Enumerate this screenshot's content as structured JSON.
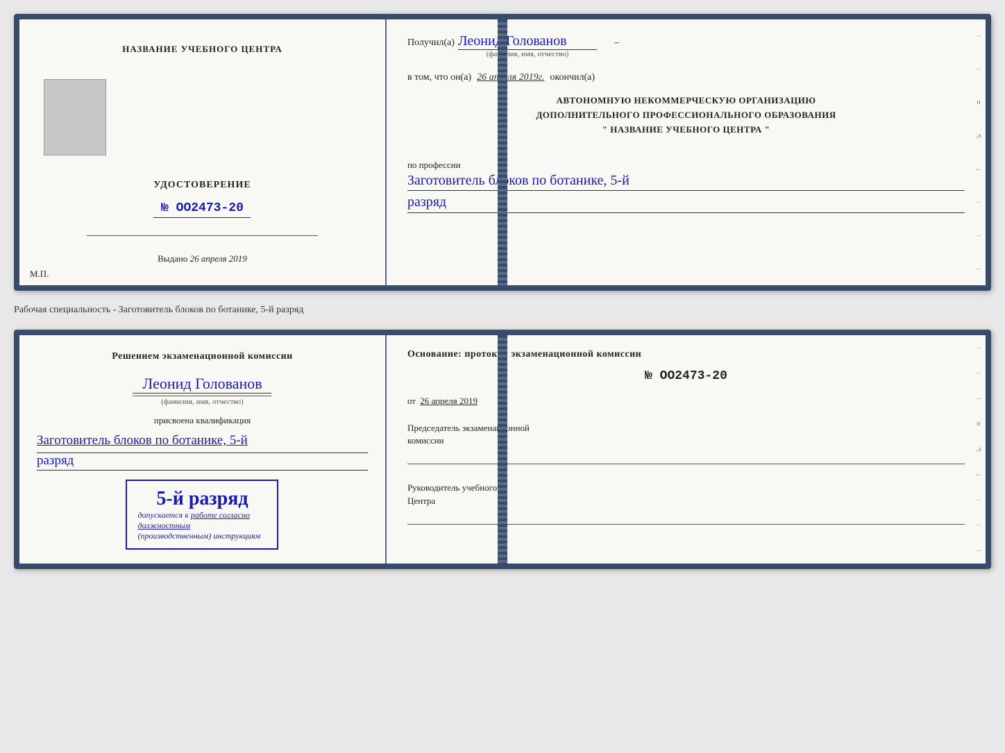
{
  "page": {
    "background": "#e8e8e8"
  },
  "top_document": {
    "left": {
      "training_center_label": "НАЗВАНИЕ УЧЕБНОГО ЦЕНТРА",
      "certificate_title": "УДОСТОВЕРЕНИЕ",
      "certificate_number": "№ OO2473-20",
      "issued_label": "Выдано",
      "issued_date": "26 апреля 2019",
      "mp_label": "М.П."
    },
    "right": {
      "received_prefix": "Получил(а)",
      "recipient_name": "Леонид Голованов",
      "fio_label": "(фамилия, имя, отчество)",
      "certifies_prefix": "в том, что он(а)",
      "completed_date": "26 апреля 2019г.",
      "completed_suffix": "окончил(а)",
      "org_line1": "АВТОНОМНУЮ НЕКОММЕРЧЕСКУЮ ОРГАНИЗАЦИЮ",
      "org_line2": "ДОПОЛНИТЕЛЬНОГО ПРОФЕССИОНАЛЬНОГО ОБРАЗОВАНИЯ",
      "org_line3": "\" НАЗВАНИЕ УЧЕБНОГО ЦЕНТРА \"",
      "profession_label": "по профессии",
      "profession_value": "Заготовитель блоков по ботанике, 5-й",
      "rank_value": "разряд"
    }
  },
  "separator": {
    "text": "Рабочая специальность - Заготовитель блоков по ботанике, 5-й разряд"
  },
  "bottom_document": {
    "left": {
      "decision_text": "Решением экзаменационной комиссии",
      "person_name": "Леонид Голованов",
      "fio_label": "(фамилия, имя, отчество)",
      "qualification_label": "присвоена квалификация",
      "qualification_value": "Заготовитель блоков по ботанике, 5-й",
      "rank_value": "разряд",
      "stamp_rank": "5-й разряд",
      "stamp_line1": "допускается к",
      "stamp_italic1": "работе согласно должностным",
      "stamp_italic2": "(производственным) инструкциям"
    },
    "right": {
      "basis_text": "Основание: протокол экзаменационной комиссии",
      "protocol_number": "№ OO2473-20",
      "date_prefix": "от",
      "date_value": "26 апреля 2019",
      "chairman_label": "Председатель экзаменационной",
      "chairman_label2": "комиссии",
      "manager_label": "Руководитель учебного",
      "manager_label2": "Центра"
    }
  }
}
